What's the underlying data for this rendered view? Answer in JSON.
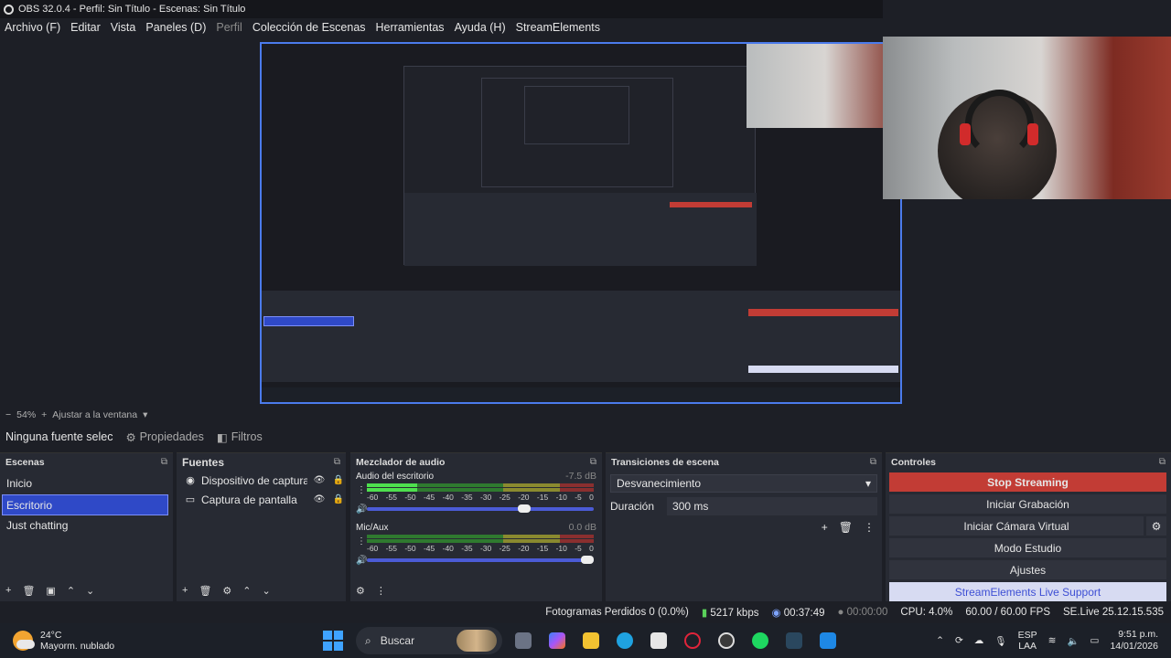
{
  "window": {
    "title": "OBS 32.0.4 - Perfil: Sin Título - Escenas: Sin Título"
  },
  "menu": [
    {
      "label": "Archivo (F)",
      "disabled": false
    },
    {
      "label": "Editar",
      "disabled": false
    },
    {
      "label": "Vista",
      "disabled": false
    },
    {
      "label": "Paneles (D)",
      "disabled": false
    },
    {
      "label": "Perfil",
      "disabled": true
    },
    {
      "label": "Colección de Escenas",
      "disabled": false
    },
    {
      "label": "Herramientas",
      "disabled": false
    },
    {
      "label": "Ayuda (H)",
      "disabled": false
    },
    {
      "label": "StreamElements",
      "disabled": false
    }
  ],
  "preview": {
    "zoom_label": "54%",
    "fit_label": "Ajustar a la ventana"
  },
  "source_bar": {
    "selected": "Ninguna fuente selec",
    "properties": "Propiedades",
    "filters": "Filtros"
  },
  "scenes": {
    "title": "Escenas",
    "items": [
      "Inicio",
      "Escritorio",
      "Just chatting"
    ],
    "selected_index": 1
  },
  "sources": {
    "title": "Fuentes",
    "items": [
      {
        "name": "Dispositivo de captura de",
        "icon": "camera-icon"
      },
      {
        "name": "Captura de pantalla",
        "icon": "monitor-icon"
      }
    ]
  },
  "mixer": {
    "title": "Mezclador de audio",
    "ticks": [
      "-60",
      "-55",
      "-50",
      "-45",
      "-40",
      "-35",
      "-30",
      "-25",
      "-20",
      "-15",
      "-10",
      "-5",
      "0"
    ],
    "tracks": [
      {
        "name": "Audio del escritorio",
        "db": "-7.5 dB",
        "level": 0.22,
        "volume": 0.72
      },
      {
        "name": "Mic/Aux",
        "db": "0.0 dB",
        "level": 0.0,
        "volume": 1.0
      }
    ]
  },
  "transitions": {
    "title": "Transiciones de escena",
    "selected": "Desvanecimiento",
    "duration_label": "Duración",
    "duration_value": "300 ms"
  },
  "controls": {
    "title": "Controles",
    "stop_streaming": "Stop Streaming",
    "start_recording": "Iniciar Grabación",
    "start_virtual_cam": "Iniciar Cámara Virtual",
    "studio_mode": "Modo Estudio",
    "settings": "Ajustes",
    "support": "StreamElements Live Support"
  },
  "status": {
    "dropped": "Fotogramas Perdidos 0 (0.0%)",
    "bitrate": "5217 kbps",
    "stream_time": "00:37:49",
    "rec_time": "00:00:00",
    "cpu": "CPU: 4.0%",
    "fps": "60.00 / 60.00 FPS",
    "se": "SE.Live 25.12.15.535"
  },
  "taskbar": {
    "temp": "24°C",
    "weather": "Mayorm. nublado",
    "search": "Buscar",
    "lang1": "ESP",
    "lang2": "LAA",
    "time": "9:51 p.m.",
    "date": "14/01/2026"
  },
  "colors": {
    "accent": "#2f49c7",
    "stop": "#c23c35",
    "support_bg": "#d7dbf2",
    "support_fg": "#3e4fd4"
  }
}
